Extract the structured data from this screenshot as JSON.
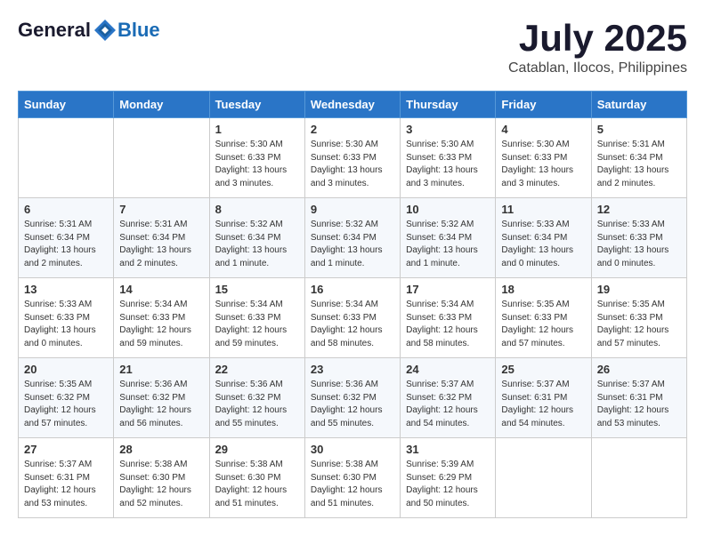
{
  "header": {
    "logo": {
      "general": "General",
      "blue": "Blue"
    },
    "title": "July 2025",
    "location": "Catablan, Ilocos, Philippines"
  },
  "weekdays": [
    "Sunday",
    "Monday",
    "Tuesday",
    "Wednesday",
    "Thursday",
    "Friday",
    "Saturday"
  ],
  "weeks": [
    [
      {
        "day": "",
        "info": ""
      },
      {
        "day": "",
        "info": ""
      },
      {
        "day": "1",
        "info": "Sunrise: 5:30 AM\nSunset: 6:33 PM\nDaylight: 13 hours and 3 minutes."
      },
      {
        "day": "2",
        "info": "Sunrise: 5:30 AM\nSunset: 6:33 PM\nDaylight: 13 hours and 3 minutes."
      },
      {
        "day": "3",
        "info": "Sunrise: 5:30 AM\nSunset: 6:33 PM\nDaylight: 13 hours and 3 minutes."
      },
      {
        "day": "4",
        "info": "Sunrise: 5:30 AM\nSunset: 6:33 PM\nDaylight: 13 hours and 3 minutes."
      },
      {
        "day": "5",
        "info": "Sunrise: 5:31 AM\nSunset: 6:34 PM\nDaylight: 13 hours and 2 minutes."
      }
    ],
    [
      {
        "day": "6",
        "info": "Sunrise: 5:31 AM\nSunset: 6:34 PM\nDaylight: 13 hours and 2 minutes."
      },
      {
        "day": "7",
        "info": "Sunrise: 5:31 AM\nSunset: 6:34 PM\nDaylight: 13 hours and 2 minutes."
      },
      {
        "day": "8",
        "info": "Sunrise: 5:32 AM\nSunset: 6:34 PM\nDaylight: 13 hours and 1 minute."
      },
      {
        "day": "9",
        "info": "Sunrise: 5:32 AM\nSunset: 6:34 PM\nDaylight: 13 hours and 1 minute."
      },
      {
        "day": "10",
        "info": "Sunrise: 5:32 AM\nSunset: 6:34 PM\nDaylight: 13 hours and 1 minute."
      },
      {
        "day": "11",
        "info": "Sunrise: 5:33 AM\nSunset: 6:34 PM\nDaylight: 13 hours and 0 minutes."
      },
      {
        "day": "12",
        "info": "Sunrise: 5:33 AM\nSunset: 6:33 PM\nDaylight: 13 hours and 0 minutes."
      }
    ],
    [
      {
        "day": "13",
        "info": "Sunrise: 5:33 AM\nSunset: 6:33 PM\nDaylight: 13 hours and 0 minutes."
      },
      {
        "day": "14",
        "info": "Sunrise: 5:34 AM\nSunset: 6:33 PM\nDaylight: 12 hours and 59 minutes."
      },
      {
        "day": "15",
        "info": "Sunrise: 5:34 AM\nSunset: 6:33 PM\nDaylight: 12 hours and 59 minutes."
      },
      {
        "day": "16",
        "info": "Sunrise: 5:34 AM\nSunset: 6:33 PM\nDaylight: 12 hours and 58 minutes."
      },
      {
        "day": "17",
        "info": "Sunrise: 5:34 AM\nSunset: 6:33 PM\nDaylight: 12 hours and 58 minutes."
      },
      {
        "day": "18",
        "info": "Sunrise: 5:35 AM\nSunset: 6:33 PM\nDaylight: 12 hours and 57 minutes."
      },
      {
        "day": "19",
        "info": "Sunrise: 5:35 AM\nSunset: 6:33 PM\nDaylight: 12 hours and 57 minutes."
      }
    ],
    [
      {
        "day": "20",
        "info": "Sunrise: 5:35 AM\nSunset: 6:32 PM\nDaylight: 12 hours and 57 minutes."
      },
      {
        "day": "21",
        "info": "Sunrise: 5:36 AM\nSunset: 6:32 PM\nDaylight: 12 hours and 56 minutes."
      },
      {
        "day": "22",
        "info": "Sunrise: 5:36 AM\nSunset: 6:32 PM\nDaylight: 12 hours and 55 minutes."
      },
      {
        "day": "23",
        "info": "Sunrise: 5:36 AM\nSunset: 6:32 PM\nDaylight: 12 hours and 55 minutes."
      },
      {
        "day": "24",
        "info": "Sunrise: 5:37 AM\nSunset: 6:32 PM\nDaylight: 12 hours and 54 minutes."
      },
      {
        "day": "25",
        "info": "Sunrise: 5:37 AM\nSunset: 6:31 PM\nDaylight: 12 hours and 54 minutes."
      },
      {
        "day": "26",
        "info": "Sunrise: 5:37 AM\nSunset: 6:31 PM\nDaylight: 12 hours and 53 minutes."
      }
    ],
    [
      {
        "day": "27",
        "info": "Sunrise: 5:37 AM\nSunset: 6:31 PM\nDaylight: 12 hours and 53 minutes."
      },
      {
        "day": "28",
        "info": "Sunrise: 5:38 AM\nSunset: 6:30 PM\nDaylight: 12 hours and 52 minutes."
      },
      {
        "day": "29",
        "info": "Sunrise: 5:38 AM\nSunset: 6:30 PM\nDaylight: 12 hours and 51 minutes."
      },
      {
        "day": "30",
        "info": "Sunrise: 5:38 AM\nSunset: 6:30 PM\nDaylight: 12 hours and 51 minutes."
      },
      {
        "day": "31",
        "info": "Sunrise: 5:39 AM\nSunset: 6:29 PM\nDaylight: 12 hours and 50 minutes."
      },
      {
        "day": "",
        "info": ""
      },
      {
        "day": "",
        "info": ""
      }
    ]
  ]
}
